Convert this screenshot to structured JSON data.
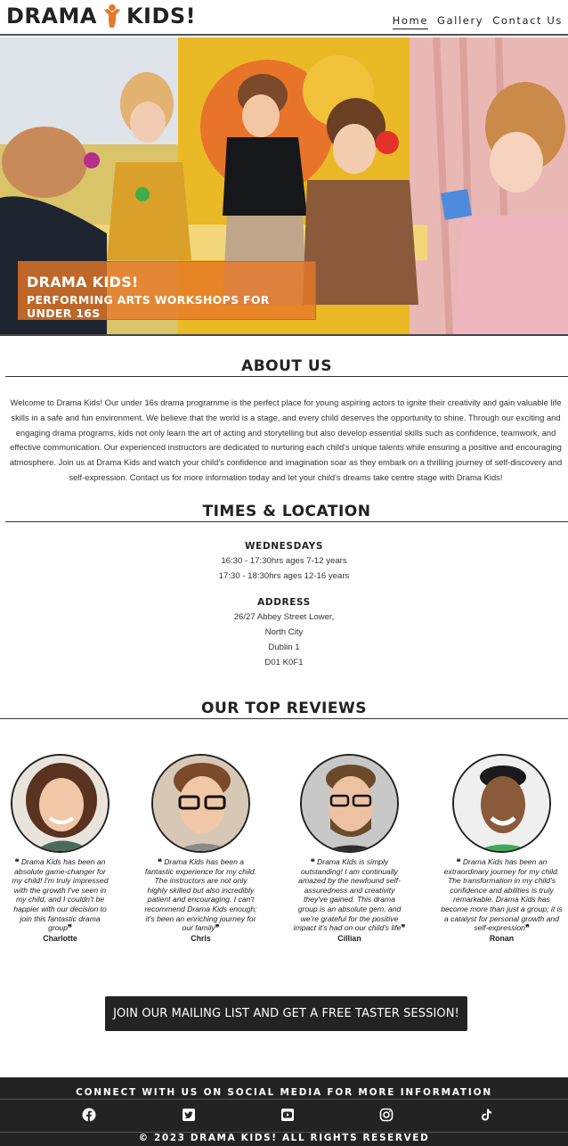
{
  "header": {
    "logo_left": "DRAMA",
    "logo_right": "KIDS!",
    "nav": [
      {
        "label": "Home",
        "active": true
      },
      {
        "label": "Gallery",
        "active": false
      },
      {
        "label": "Contact Us",
        "active": false
      }
    ]
  },
  "hero": {
    "title": "DRAMA KIDS!",
    "subtitle": "PERFORMING ARTS WORKSHOPS FOR UNDER 16S"
  },
  "about": {
    "heading": "ABOUT US",
    "text": "Welcome to Drama Kids! Our under 16s drama programme is the perfect place for young aspiring actors to ignite their creativity and gain valuable life skills in a safe and fun environment. We believe that the world is a stage, and every child deserves the opportunity to shine. Through our exciting and engaging drama programs, kids not only learn the art of acting and storytelling but also develop essential skills such as confidence, teamwork, and effective communication. Our experienced instructors are dedicated to nurturing each child's unique talents while ensuring a positive and encouraging atmosphere. Join us at Drama Kids and watch your child's confidence and imagination soar as they embark on a thrilling journey of self-discovery and self-expression. Contact us for more information today and let your child's dreams take centre stage with Drama Kids!"
  },
  "times": {
    "heading": "TIMES & LOCATION",
    "day": "WEDNESDAYS",
    "sessions": [
      "16:30 - 17:30hrs ages 7-12 years",
      "17:30 - 18:30hrs ages 12-16 years"
    ],
    "address_heading": "ADDRESS",
    "address": [
      "26/27 Abbey Street Lower,",
      "North City",
      "Dublin 1",
      "D01 K0F1"
    ]
  },
  "reviews": {
    "heading": "OUR TOP REVIEWS",
    "items": [
      {
        "name": "Charlotte",
        "open_mark": "❝",
        "close_mark": "❞",
        "quote": "Drama Kids has been an absolute game-changer for my child! I'm truly impressed with the growth I've seen in my child, and I couldn't be happier with our decision to join this fantastic drama group"
      },
      {
        "name": "Chris",
        "open_mark": "❝",
        "close_mark": "❞",
        "quote": "Drama Kids has been a fantastic experience for my child. The instructors are not only highly skilled but also incredibly patient and encouraging. I can't recommend Drama Kids enough; it's been an enriching journey for our family"
      },
      {
        "name": "Cillian",
        "open_mark": "❝",
        "close_mark": "❞",
        "quote": "Drama Kids is simply outstanding! I am continually amazed by the newfound self-assuredness and creativity they've gained. This drama group is an absolute gem, and we're grateful for the positive impact it's had on our child's life"
      },
      {
        "name": "Ronan",
        "open_mark": "❝",
        "close_mark": "❞",
        "quote": "Drama Kids has been an extraordinary journey for my child. The transformation in my child's confidence and abilities is truly remarkable. Drama Kids has become more than just a group; it is a catalyst for personal growth and self-expression"
      }
    ]
  },
  "cta": {
    "label": "JOIN OUR MAILING LIST AND GET A FREE TASTER SESSION!"
  },
  "footer": {
    "title": "CONNECT WITH US ON SOCIAL MEDIA FOR MORE INFORMATION",
    "social": [
      "facebook-icon",
      "twitter-icon",
      "youtube-icon",
      "instagram-icon",
      "tiktok-icon"
    ],
    "copyright": "© 2023 DRAMA KIDS! ALL RIGHTS RESERVED"
  },
  "colors": {
    "accent": "#e6782a",
    "dark": "#232323"
  }
}
